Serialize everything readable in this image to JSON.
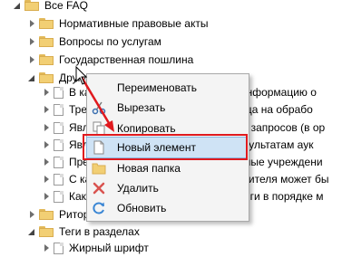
{
  "tree": {
    "items": [
      {
        "label": "Все FAQ",
        "icon": "folder-icon",
        "expander": "expanded"
      },
      {
        "label": "Нормативные правовые акты",
        "icon": "folder-icon",
        "expander": "collapsed"
      },
      {
        "label": "Вопросы по услугам",
        "icon": "folder-icon",
        "expander": "collapsed"
      },
      {
        "label": "Государственная пошлина",
        "icon": "folder-icon",
        "expander": "collapsed"
      },
      {
        "label": "Другие",
        "icon": "folder-icon",
        "expander": "expanded"
      },
      {
        "label": "В каком порядке можно получать информацию о",
        "icon": "document-icon",
        "expander": "collapsed"
      },
      {
        "label": "Требуется ли согласие третьего лица на обрабо",
        "icon": "document-icon",
        "expander": "collapsed"
      },
      {
        "label": "Является ли получение нескольких запросов (в ор",
        "icon": "document-icon",
        "expander": "collapsed"
      },
      {
        "label": "Является ли законным отказ по результатам аук",
        "icon": "document-icon",
        "expander": "collapsed"
      },
      {
        "label": "Предоставляются ли государственные учреждени",
        "icon": "document-icon",
        "expander": "collapsed"
      },
      {
        "label": "С какого момента полномочия заявителя может бы",
        "icon": "document-icon",
        "expander": "collapsed"
      },
      {
        "label": "Каким образом можно получить книги в порядке м",
        "icon": "document-icon",
        "expander": "collapsed"
      },
      {
        "label": "Ритор",
        "icon": "folder-icon",
        "expander": "collapsed"
      },
      {
        "label": "Теги в разделах",
        "icon": "folder-icon",
        "expander": "collapsed"
      },
      {
        "label": "Жирный шрифт",
        "icon": "document-icon",
        "expander": "collapsed"
      }
    ]
  },
  "context_menu": {
    "items": [
      {
        "label": "Переименовать",
        "icon": ""
      },
      {
        "label": "Вырезать",
        "icon": "scissors-icon"
      },
      {
        "label": "Копировать",
        "icon": "copy-icon"
      },
      {
        "label": "Новый элемент",
        "icon": "new-document-icon",
        "highlighted": true
      },
      {
        "label": "Новая папка",
        "icon": "folder-icon"
      },
      {
        "label": "Удалить",
        "icon": "delete-x-icon"
      },
      {
        "label": "Обновить",
        "icon": "refresh-icon"
      }
    ]
  },
  "colors": {
    "highlight_box": "#e0191e",
    "menu_hover": "#cfe3f5",
    "folder": "#f2cf74",
    "delete_icon": "#d9534f",
    "refresh_icon": "#3a86d4"
  }
}
